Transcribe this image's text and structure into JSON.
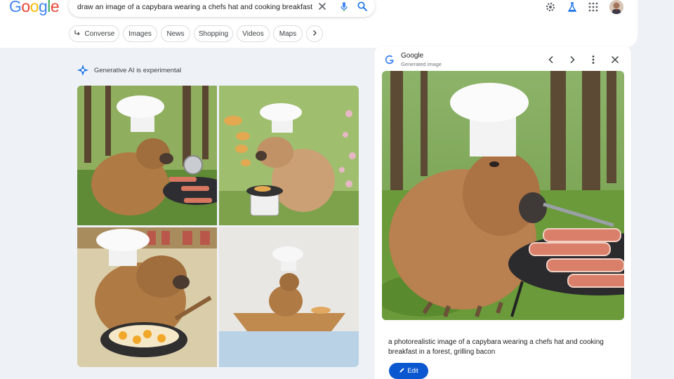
{
  "logo": {
    "letters": [
      "G",
      "o",
      "o",
      "g",
      "l",
      "e"
    ],
    "colors": [
      "#4285f4",
      "#ea4335",
      "#fbbc05",
      "#4285f4",
      "#34a853",
      "#ea4335"
    ]
  },
  "search": {
    "query": "draw an image of a capybara wearing a chefs hat and cooking breakfast"
  },
  "chips": [
    {
      "label": "Converse",
      "icon": "converse-arrow-icon"
    },
    {
      "label": "Images"
    },
    {
      "label": "News"
    },
    {
      "label": "Shopping"
    },
    {
      "label": "Videos"
    },
    {
      "label": "Maps"
    }
  ],
  "notice": {
    "text": "Generative AI is experimental"
  },
  "results": {
    "tiles": [
      "capybara-chef-grilling-bacon-forest",
      "capybara-chef-flipping-pancakes-garden",
      "capybara-chef-frying-eggs-kitchen",
      "capybara-chef-in-boat-watercolor"
    ]
  },
  "panel": {
    "source": "Google",
    "subtitle": "Generated image",
    "caption": "a photorealistic image of a capybara wearing a chefs hat and cooking breakfast in a forest, grilling bacon",
    "edit_label": "Edit"
  },
  "colors": {
    "accent": "#0b57d0",
    "background": "#eef1f6"
  }
}
